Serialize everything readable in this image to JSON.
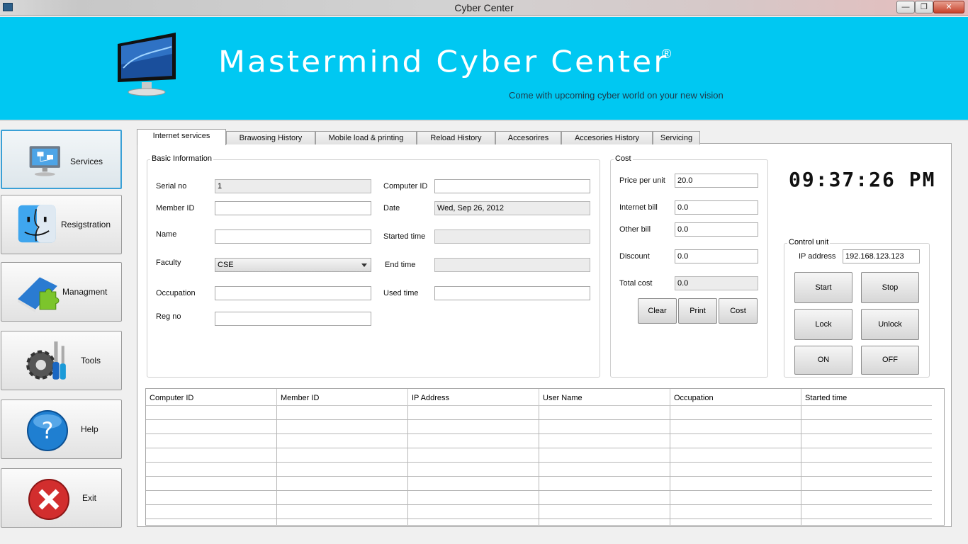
{
  "window": {
    "title": "Cyber Center",
    "min": "—",
    "max": "❐",
    "close": "✕"
  },
  "banner": {
    "title": "Mastermind  Cyber Center",
    "registered": "®",
    "tagline": "Come with upcoming cyber world on your new vision"
  },
  "nav": [
    {
      "label": "Services",
      "icon": "computer-network-icon"
    },
    {
      "label": "Resigstration",
      "icon": "finder-face-icon"
    },
    {
      "label": "Managment",
      "icon": "puzzle-book-icon"
    },
    {
      "label": "Tools",
      "icon": "gear-screwdriver-icon"
    },
    {
      "label": "Help",
      "icon": "question-icon"
    },
    {
      "label": "Exit",
      "icon": "close-icon"
    }
  ],
  "tabs": [
    "Internet services",
    "Brawosing History",
    "Mobile load & printing",
    "Reload History",
    "Accesorires",
    "Accesories History",
    "Servicing"
  ],
  "basic": {
    "title": "Basic Information",
    "serial_label": "Serial no",
    "serial_value": "1",
    "member_label": "Member ID",
    "member_value": "",
    "name_label": "Name",
    "name_value": "",
    "faculty_label": "Faculty",
    "faculty_value": "CSE",
    "occupation_label": "Occupation",
    "occupation_value": "",
    "regno_label": "Reg no",
    "regno_value": "",
    "computer_label": "Computer ID",
    "computer_value": "",
    "date_label": "Date",
    "date_value": "Wed, Sep 26, 2012",
    "started_label": "Started time",
    "started_value": "",
    "end_label": "End time",
    "end_value": "",
    "used_label": "Used time",
    "used_value": ""
  },
  "cost": {
    "title": "Cost",
    "ppu_label": "Price per unit",
    "ppu_value": "20.0",
    "internet_label": "Internet bill",
    "internet_value": "0.0",
    "other_label": "Other bill",
    "other_value": "0.0",
    "discount_label": "Discount",
    "discount_value": "0.0",
    "total_label": "Total cost",
    "total_value": "0.0",
    "clear": "Clear",
    "print": "Print",
    "cost": "Cost"
  },
  "clock": "09:37:26 PM",
  "control": {
    "title": "Control unit",
    "ip_label": "IP address",
    "ip_value": "192.168.123.123",
    "start": "Start",
    "stop": "Stop",
    "lock": "Lock",
    "unlock": "Unlock",
    "on": "ON",
    "off": "OFF"
  },
  "table": {
    "columns": [
      "Computer ID",
      "Member ID",
      "IP Address",
      "User Name",
      "Occupation",
      "Started time"
    ],
    "rows": []
  },
  "colors": {
    "banner": "#00c8f2",
    "active_nav": "#3aa0d6"
  }
}
